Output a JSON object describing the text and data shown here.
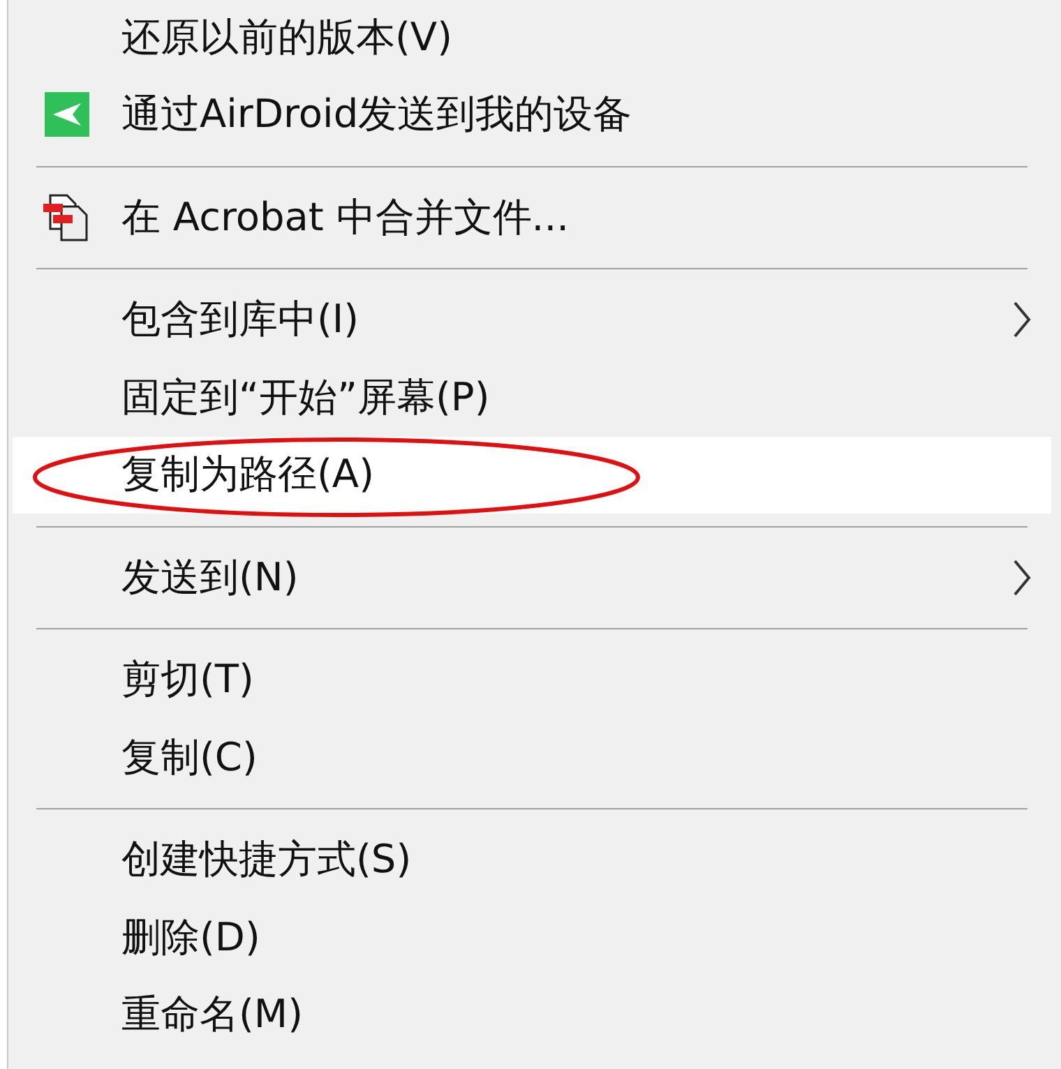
{
  "menu": [
    {
      "kind": "item",
      "label": "还原以前的版本(V)",
      "submenu": false,
      "selected": false,
      "circled": false
    },
    {
      "kind": "send-item",
      "label": "通过AirDroid发送到我的设备",
      "submenu": false,
      "selected": false,
      "circled": false
    },
    {
      "kind": "separator"
    },
    {
      "kind": "merge-item",
      "label": "在 Acrobat 中合并文件...",
      "submenu": false,
      "selected": false,
      "circled": false
    },
    {
      "kind": "separator"
    },
    {
      "kind": "item",
      "label": "包含到库中(I)",
      "submenu": true,
      "selected": false,
      "circled": false
    },
    {
      "kind": "item",
      "label": "固定到“开始”屏幕(P)",
      "submenu": false,
      "selected": false,
      "circled": false
    },
    {
      "kind": "item",
      "label": "复制为路径(A)",
      "submenu": false,
      "selected": true,
      "circled": true
    },
    {
      "kind": "separator"
    },
    {
      "kind": "item",
      "label": "发送到(N)",
      "submenu": true,
      "selected": false,
      "circled": false
    },
    {
      "kind": "separator"
    },
    {
      "kind": "item",
      "label": "剪切(T)",
      "submenu": false,
      "selected": false,
      "circled": false
    },
    {
      "kind": "item",
      "label": "复制(C)",
      "submenu": false,
      "selected": false,
      "circled": false
    },
    {
      "kind": "separator"
    },
    {
      "kind": "item",
      "label": "创建快捷方式(S)",
      "submenu": false,
      "selected": false,
      "circled": false
    },
    {
      "kind": "item",
      "label": "删除(D)",
      "submenu": false,
      "selected": false,
      "circled": false
    },
    {
      "kind": "item",
      "label": "重命名(M)",
      "submenu": false,
      "selected": false,
      "circled": false
    }
  ]
}
